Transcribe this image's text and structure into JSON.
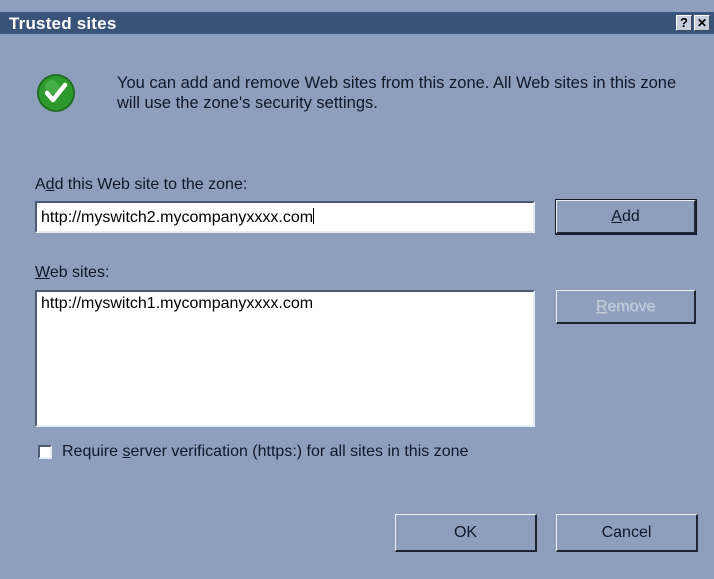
{
  "window": {
    "title": "Trusted sites",
    "help_label": "?",
    "close_label": "✕"
  },
  "info": {
    "icon": "green-checkmark-icon",
    "text": "You can add and remove Web sites from this zone. All Web sites in this zone will use the zone's security settings."
  },
  "add_site": {
    "label_pre": "A",
    "label_accel": "d",
    "label_post": "d this Web site to the zone:",
    "value": "http://myswitch2.mycompanyxxxx.com",
    "button_accel": "A",
    "button_post": "dd"
  },
  "web_sites": {
    "label_accel": "W",
    "label_post": "eb sites:",
    "items": [
      "http://myswitch1.mycompanyxxxx.com"
    ],
    "remove_accel": "R",
    "remove_post": "emove"
  },
  "verification": {
    "checked": false,
    "label_pre": "Require ",
    "label_accel": "s",
    "label_post": "erver verification (https:) for all sites in this zone"
  },
  "footer": {
    "ok_label": "OK",
    "cancel_label": "Cancel"
  },
  "colors": {
    "dialog_bg": "#8d9fbd",
    "titlebar_bg": "#3a5378",
    "check_green": "#2e9a2e"
  }
}
